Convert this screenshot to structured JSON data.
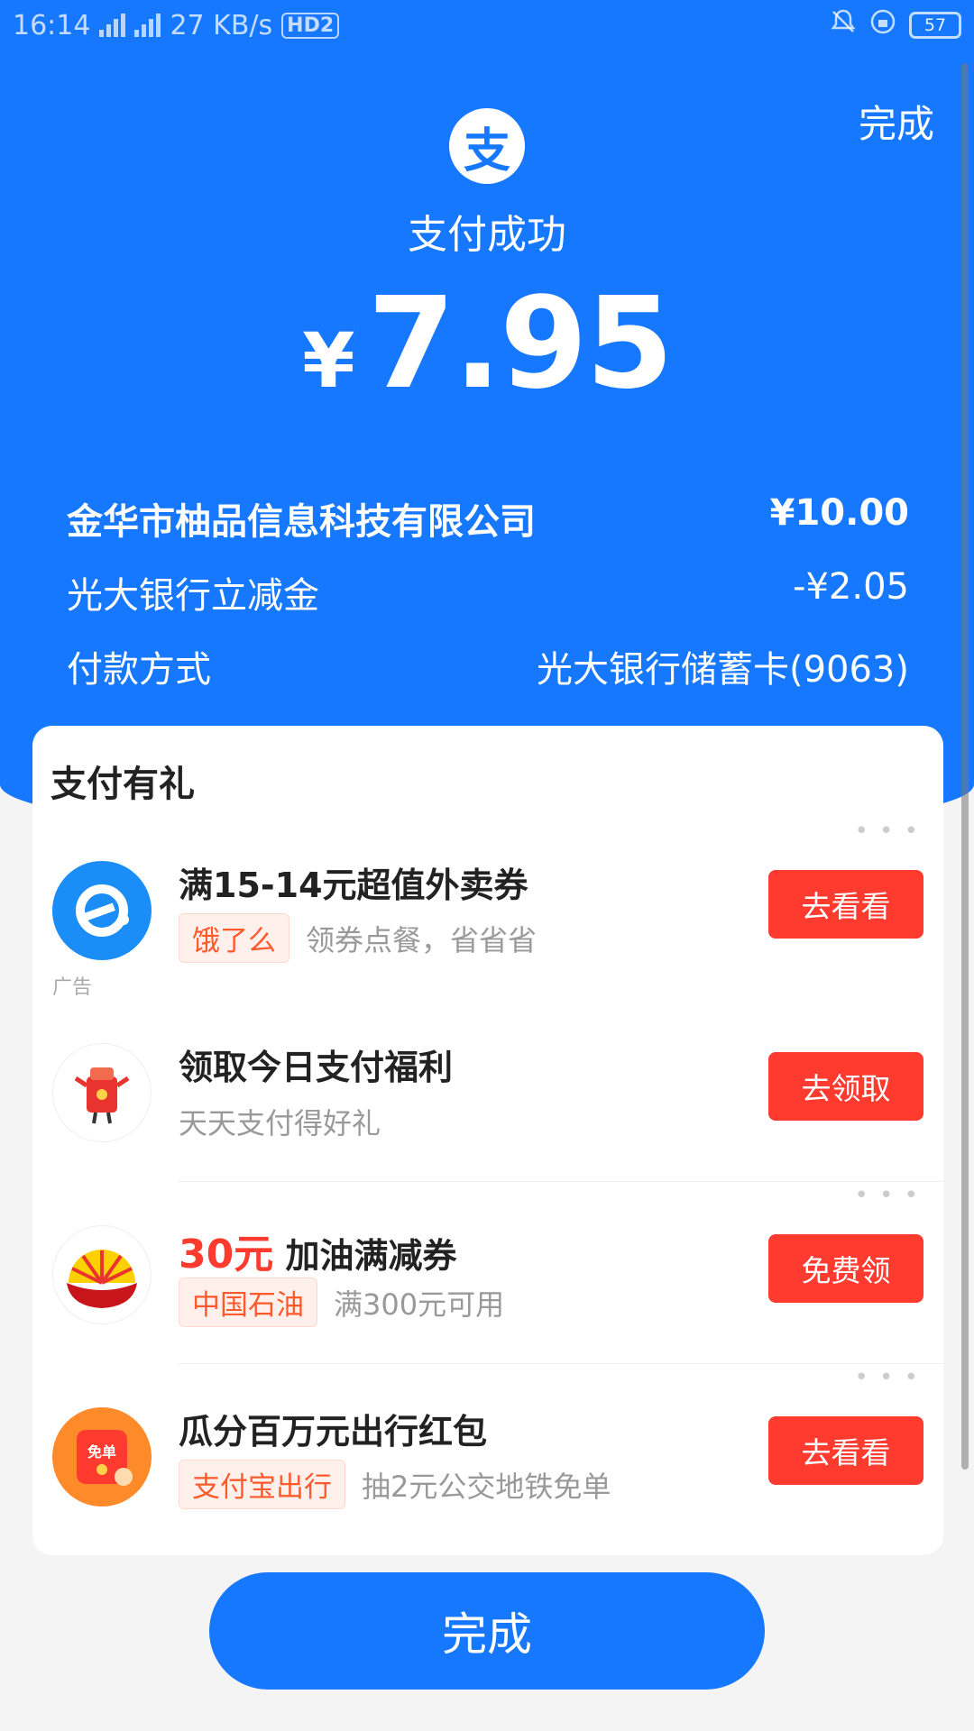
{
  "status_bar": {
    "time": "16:14",
    "network_speed": "27 KB/s",
    "hd_label": "HD2",
    "battery": "57"
  },
  "header": {
    "done_label": "完成",
    "logo_char": "支",
    "title": "支付成功",
    "currency": "¥",
    "amount": "7.95"
  },
  "details": {
    "merchant": "金华市柚品信息科技有限公司",
    "merchant_amount": "¥10.00",
    "discount_label": "光大银行立减金",
    "discount_amount": "-¥2.05",
    "method_label": "付款方式",
    "method_value": "光大银行储蓄卡(9063)"
  },
  "rewards": {
    "title": "支付有礼",
    "ad_label": "广告",
    "items": [
      {
        "icon": "eleme-icon",
        "title": "满15-14元超值外卖券",
        "tag": "饿了么",
        "desc": "领券点餐，省省省",
        "button": "去看看"
      },
      {
        "icon": "red-envelope-icon",
        "title": "领取今日支付福利",
        "desc": "天天支付得好礼",
        "button": "去领取"
      },
      {
        "icon": "petrochina-icon",
        "title_highlight": "30元",
        "title": "加油满减券",
        "tag": "中国石油",
        "desc": "满300元可用",
        "button": "免费领"
      },
      {
        "icon": "travel-redpacket-icon",
        "icon_text": "免单",
        "title": "瓜分百万元出行红包",
        "tag": "支付宝出行",
        "desc": "抽2元公交地铁免单",
        "button": "去看看"
      }
    ]
  },
  "footer": {
    "done_label": "完成"
  },
  "colors": {
    "brand_blue": "#1677ff",
    "action_red": "#ff3b30",
    "tag_orange": "#ff5a2c"
  }
}
